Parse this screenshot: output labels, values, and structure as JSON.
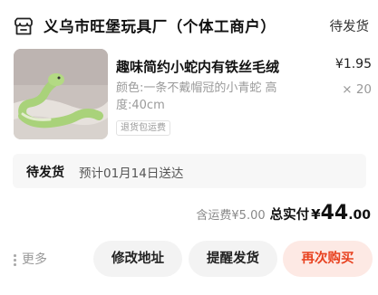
{
  "header": {
    "shop_icon": "storefront-icon",
    "shop_name": "义乌市旺堡玩具厂（个体工商户）",
    "status": "待发货"
  },
  "product": {
    "image_icon": "plush-snake-photo",
    "title": "趣味简约小蛇内有铁丝毛绒",
    "price": "¥1.95",
    "quantity": "× 20",
    "spec": "颜色:一条不戴帽冠的小青蛇 高度:40cm",
    "tag": "退货包运费"
  },
  "delivery": {
    "status": "待发货",
    "eta": "预计01月14日送达"
  },
  "totals": {
    "shipping": "含运费¥5.00",
    "total_label": "总实付",
    "currency": "¥",
    "amount_int": "44",
    "amount_dec": ".00"
  },
  "actions": {
    "more": "更多",
    "change_address": "修改地址",
    "remind_ship": "提醒发货",
    "rebuy": "再次购买"
  },
  "colors": {
    "accent": "#e8411f",
    "accent_bg": "#fde9e4",
    "button_bg": "#f3f3f3",
    "muted_text": "#999999"
  }
}
